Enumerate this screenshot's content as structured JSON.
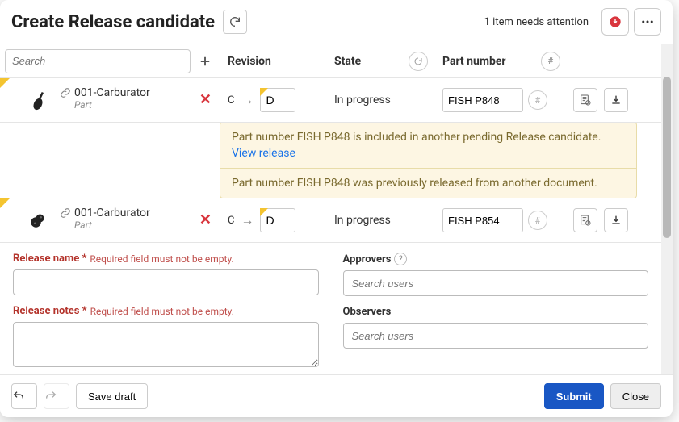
{
  "header": {
    "title": "Create Release candidate",
    "attention": "1 item needs attention"
  },
  "search": {
    "placeholder": "Search"
  },
  "columns": {
    "revision": "Revision",
    "state": "State",
    "part_number": "Part number"
  },
  "rows": [
    {
      "name": "001-Carburator",
      "type": "Part",
      "rev_from": "C",
      "rev_to": "D",
      "state": "In progress",
      "part_number": "FISH P848",
      "flagged": true,
      "warnings": [
        {
          "text": "Part number FISH P848 is included in another pending Release candidate.",
          "link": "View release"
        },
        {
          "text": "Part number FISH P848 was previously released from another document."
        }
      ]
    },
    {
      "name": "001-Carburator",
      "type": "Part",
      "rev_from": "C",
      "rev_to": "D",
      "state": "In progress",
      "part_number": "FISH P854",
      "flagged": true,
      "warnings": []
    }
  ],
  "form": {
    "release_name_label": "Release name *",
    "release_name_req": "Required field must not be empty.",
    "release_notes_label": "Release notes *",
    "release_notes_req": "Required field must not be empty.",
    "approvers_label": "Approvers",
    "observers_label": "Observers",
    "search_users_placeholder": "Search users"
  },
  "footer": {
    "save_draft": "Save draft",
    "submit": "Submit",
    "close": "Close"
  }
}
